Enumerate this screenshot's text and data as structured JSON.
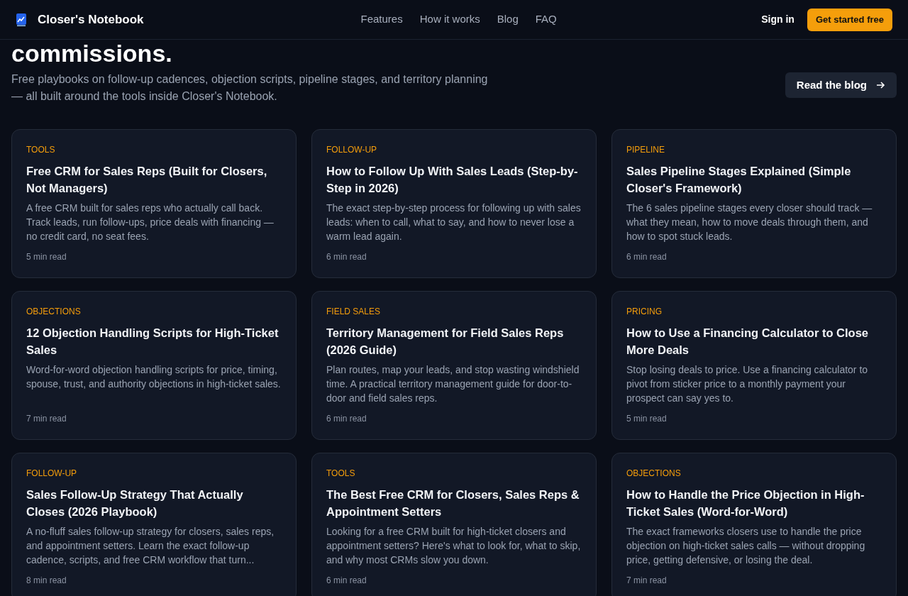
{
  "header": {
    "brand": "Closer's Notebook",
    "nav": [
      "Features",
      "How it works",
      "Blog",
      "FAQ"
    ],
    "sign_in": "Sign in",
    "cta": "Get started free"
  },
  "hero": {
    "heading": "commissions.",
    "description": "Free playbooks on follow-up cadences, objection scripts, pipeline stages, and territory planning — all built around the tools inside Closer's Notebook.",
    "button": "Read the blog"
  },
  "posts": [
    {
      "category": "TOOLS",
      "title": "Free CRM for Sales Reps (Built for Closers, Not Managers)",
      "excerpt": "A free CRM built for sales reps who actually call back. Track leads, run follow-ups, price deals with financing — no credit card, no seat fees.",
      "read_time": "5 min read"
    },
    {
      "category": "FOLLOW-UP",
      "title": "How to Follow Up With Sales Leads (Step-by-Step in 2026)",
      "excerpt": "The exact step-by-step process for following up with sales leads: when to call, what to say, and how to never lose a warm lead again.",
      "read_time": "6 min read"
    },
    {
      "category": "PIPELINE",
      "title": "Sales Pipeline Stages Explained (Simple Closer's Framework)",
      "excerpt": "The 6 sales pipeline stages every closer should track — what they mean, how to move deals through them, and how to spot stuck leads.",
      "read_time": "6 min read"
    },
    {
      "category": "OBJECTIONS",
      "title": "12 Objection Handling Scripts for High-Ticket Sales",
      "excerpt": "Word-for-word objection handling scripts for price, timing, spouse, trust, and authority objections in high-ticket sales.",
      "read_time": "7 min read"
    },
    {
      "category": "FIELD SALES",
      "title": "Territory Management for Field Sales Reps (2026 Guide)",
      "excerpt": "Plan routes, map your leads, and stop wasting windshield time. A practical territory management guide for door-to-door and field sales reps.",
      "read_time": "6 min read"
    },
    {
      "category": "PRICING",
      "title": "How to Use a Financing Calculator to Close More Deals",
      "excerpt": "Stop losing deals to price. Use a financing calculator to pivot from sticker price to a monthly payment your prospect can say yes to.",
      "read_time": "5 min read"
    },
    {
      "category": "FOLLOW-UP",
      "title": "Sales Follow-Up Strategy That Actually Closes (2026 Playbook)",
      "excerpt": "A no-fluff sales follow-up strategy for closers, sales reps, and appointment setters. Learn the exact follow-up cadence, scripts, and free CRM workflow that turn...",
      "read_time": "8 min read"
    },
    {
      "category": "TOOLS",
      "title": "The Best Free CRM for Closers, Sales Reps & Appointment Setters",
      "excerpt": "Looking for a free CRM built for high-ticket closers and appointment setters? Here's what to look for, what to skip, and why most CRMs slow you down.",
      "read_time": "6 min read"
    },
    {
      "category": "OBJECTIONS",
      "title": "How to Handle the Price Objection in High-Ticket Sales (Word-for-Word)",
      "excerpt": "The exact frameworks closers use to handle the price objection on high-ticket sales calls — without dropping price, getting defensive, or losing the deal.",
      "read_time": "7 min read"
    }
  ]
}
